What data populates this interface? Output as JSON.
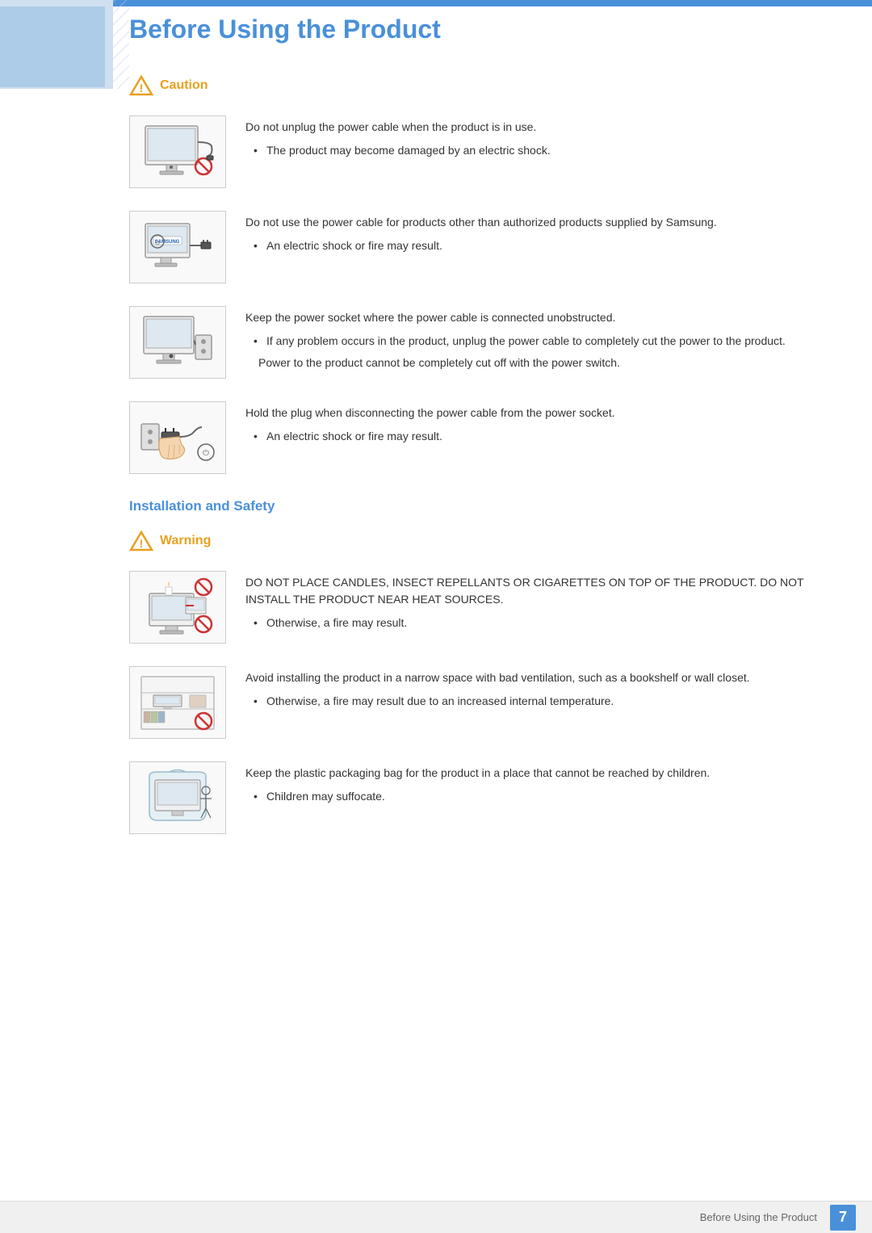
{
  "header": {
    "title": "Before Using the Product"
  },
  "caution_section": {
    "label": "Caution",
    "items": [
      {
        "id": "item1",
        "main_text": "Do not unplug the power cable when the product is in use.",
        "bullets": [
          "The product may become damaged by an electric shock."
        ],
        "sub_texts": []
      },
      {
        "id": "item2",
        "main_text": "Do not use the power cable for products other than authorized products supplied by Samsung.",
        "bullets": [
          "An electric shock or fire may result."
        ],
        "sub_texts": []
      },
      {
        "id": "item3",
        "main_text": "Keep the power socket where the power cable is connected unobstructed.",
        "bullets": [
          "If any problem occurs in the product, unplug the power cable to completely cut the power to the product."
        ],
        "sub_texts": [
          "Power to the product cannot be completely cut off with the power switch."
        ]
      },
      {
        "id": "item4",
        "main_text": "Hold the plug when disconnecting the power cable from the power socket.",
        "bullets": [
          "An electric shock or fire may result."
        ],
        "sub_texts": []
      }
    ]
  },
  "installation_safety": {
    "title": "Installation and Safety",
    "warning_label": "Warning",
    "items": [
      {
        "id": "warn1",
        "main_text": "DO NOT PLACE CANDLES, INSECT REPELLANTS OR CIGARETTES ON TOP OF THE PRODUCT. DO NOT INSTALL THE PRODUCT NEAR HEAT SOURCES.",
        "bullets": [
          "Otherwise, a fire may result."
        ],
        "sub_texts": []
      },
      {
        "id": "warn2",
        "main_text": "Avoid installing the product in a narrow space with bad ventilation, such as a bookshelf or wall closet.",
        "bullets": [
          "Otherwise, a fire may result due to an increased internal temperature."
        ],
        "sub_texts": []
      },
      {
        "id": "warn3",
        "main_text": "Keep the plastic packaging bag for the product in a place that cannot be reached by children.",
        "bullets": [
          "Children may suffocate."
        ],
        "sub_texts": []
      }
    ]
  },
  "footer": {
    "text": "Before Using the Product",
    "page_number": "7"
  }
}
